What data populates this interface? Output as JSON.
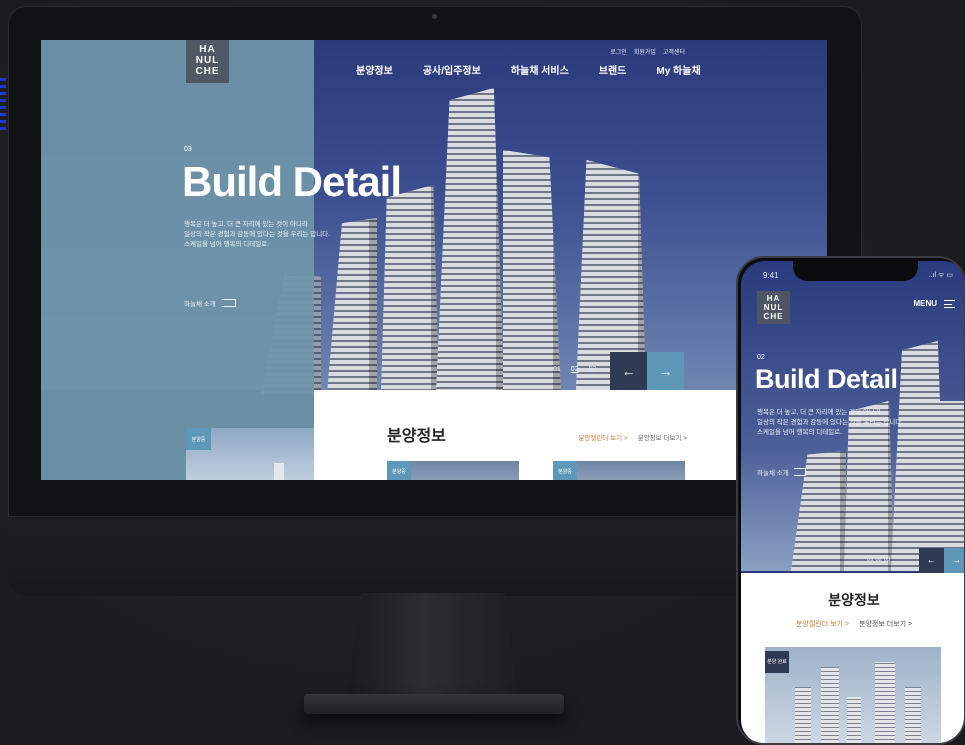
{
  "desktop": {
    "logo": [
      "HA",
      "NUL",
      "CHE"
    ],
    "util_links": [
      "로그인",
      "회원가입",
      "고객센터"
    ],
    "nav": [
      "분양정보",
      "공사/입주정보",
      "하늘채 서비스",
      "브랜드",
      "My 하늘채"
    ],
    "slide_number": "03",
    "hero_title": "Build Detail",
    "hero_desc_1": "행복은 더 높고, 더 큰 자리에 있는 것이 아니라",
    "hero_desc_2": "일상의 작은 경험과 감동에 있다는 것을 우리는 압니다.",
    "hero_desc_3": "스케일을 넘어 행복의 디테일로.",
    "hero_link": "하늘채 소개",
    "pager": [
      "01",
      "02",
      "03"
    ],
    "pager_active": "02",
    "section_title": "분양정보",
    "more_calendar": "분양캘린더 보기 >",
    "more_info": "분양정보 더보기 >",
    "card_tag": "분양중",
    "left_card_tag": "분양중"
  },
  "phone": {
    "time": "9:41",
    "status": "..ıl ᯤ ▭",
    "logo": [
      "HA",
      "NUL",
      "CHE"
    ],
    "menu_label": "MENU",
    "slide_number": "02",
    "hero_title": "Build Detail",
    "hero_desc_1": "행복은 더 높고, 더 큰 자리에 있는 것이 아니라",
    "hero_desc_2": "일상의 작은 경험과 감동에 있다는 것을 우리는 압니다.",
    "hero_desc_3": "스케일을 넘어 행복의 디테일로.",
    "hero_link": "하늘채 소개",
    "pager": "01  02  03",
    "section_title": "분양정보",
    "more_calendar": "분양캘린더 보기 >",
    "more_info": "분양정보 더보기 >",
    "card_tag": "분양 완료"
  },
  "colors": {
    "accent_blue": "#5e98b8",
    "navy": "#2f3a55",
    "orange": "#d17a3a"
  },
  "icons": [
    "arrow-left-icon",
    "arrow-right-icon",
    "hamburger-icon",
    "calendar-icon"
  ]
}
